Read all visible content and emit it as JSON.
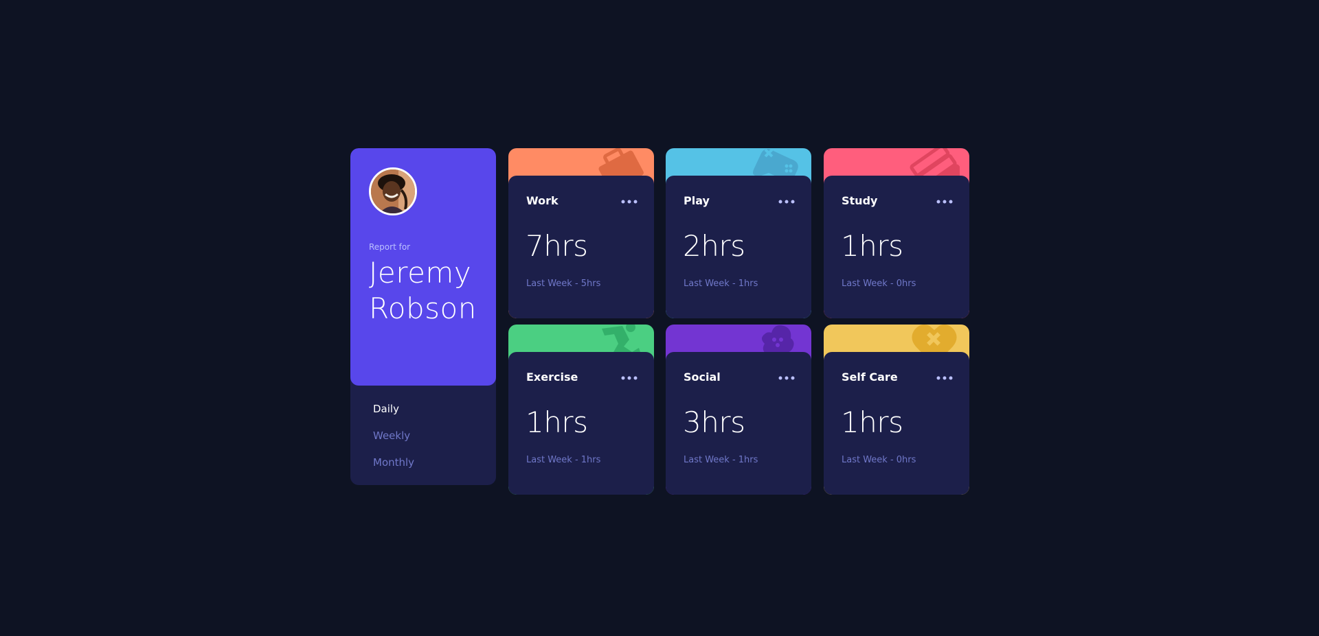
{
  "profile": {
    "report_for": "Report for",
    "name": "Jeremy Robson"
  },
  "periods": [
    {
      "label": "Daily",
      "active": true
    },
    {
      "label": "Weekly",
      "active": false
    },
    {
      "label": "Monthly",
      "active": false
    }
  ],
  "activities": [
    {
      "title": "Work",
      "hours": "7hrs",
      "previous": "Last Week - 5hrs",
      "color": "#ff8b64",
      "icon": "briefcase-icon"
    },
    {
      "title": "Play",
      "hours": "2hrs",
      "previous": "Last Week - 1hrs",
      "color": "#55c2e6",
      "icon": "gamepad-icon"
    },
    {
      "title": "Study",
      "hours": "1hrs",
      "previous": "Last Week - 0hrs",
      "color": "#ff5e7d",
      "icon": "books-icon"
    },
    {
      "title": "Exercise",
      "hours": "1hrs",
      "previous": "Last Week - 1hrs",
      "color": "#4bcf82",
      "icon": "runner-icon"
    },
    {
      "title": "Social",
      "hours": "3hrs",
      "previous": "Last Week - 1hrs",
      "color": "#7335d2",
      "icon": "social-icon"
    },
    {
      "title": "Self Care",
      "hours": "1hrs",
      "previous": "Last Week - 0hrs",
      "color": "#f1c75b",
      "icon": "heart-bandage-icon"
    }
  ]
}
